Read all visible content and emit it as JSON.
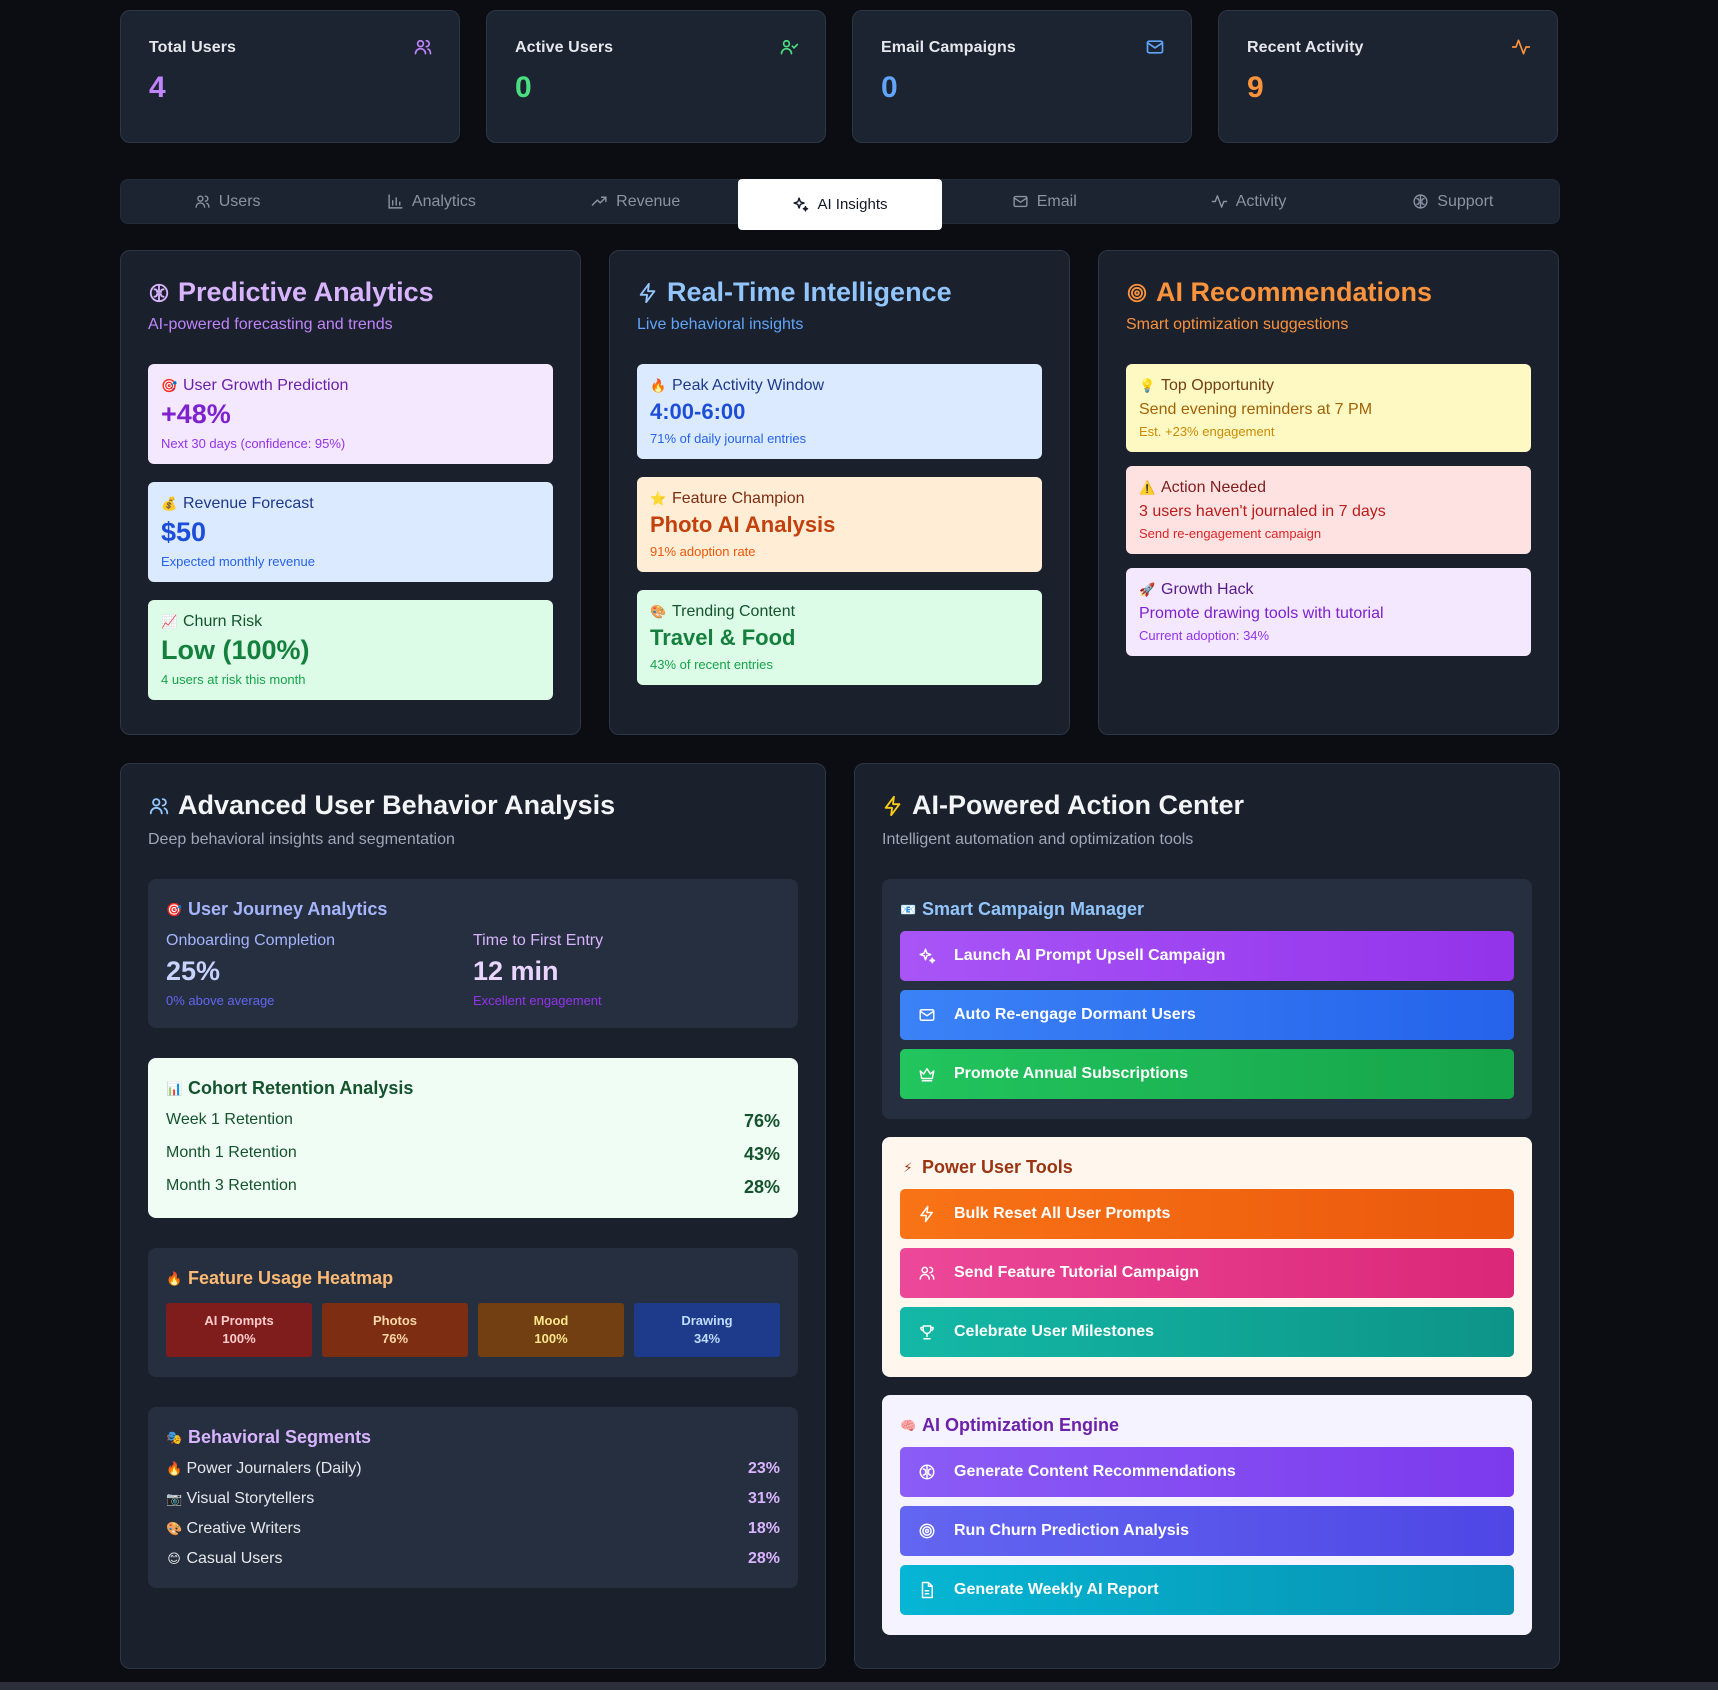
{
  "stats": [
    {
      "label": "Total Users",
      "value": "4",
      "color": "#c084fc",
      "icon": "users-icon"
    },
    {
      "label": "Active Users",
      "value": "0",
      "color": "#4ade80",
      "icon": "user-check-icon"
    },
    {
      "label": "Email Campaigns",
      "value": "0",
      "color": "#60a5fa",
      "icon": "mail-icon"
    },
    {
      "label": "Recent Activity",
      "value": "9",
      "color": "#fb923c",
      "icon": "activity-icon"
    }
  ],
  "tabs": [
    {
      "label": "Users",
      "icon": "users-icon"
    },
    {
      "label": "Analytics",
      "icon": "bar-chart-icon"
    },
    {
      "label": "Revenue",
      "icon": "trending-up-icon"
    },
    {
      "label": "AI Insights",
      "icon": "sparkles-icon",
      "active": true
    },
    {
      "label": "Email",
      "icon": "mail-icon"
    },
    {
      "label": "Activity",
      "icon": "activity-icon"
    },
    {
      "label": "Support",
      "icon": "brain-icon"
    }
  ],
  "predictive": {
    "title": "Predictive Analytics",
    "subtitle": "AI-powered forecasting and trends",
    "cards": [
      {
        "emoji": "🎯",
        "label": "User Growth Prediction",
        "value": "+48%",
        "note": "Next 30 days (confidence: 95%)"
      },
      {
        "emoji": "💰",
        "label": "Revenue Forecast",
        "value": "$50",
        "note": "Expected monthly revenue"
      },
      {
        "emoji": "📈",
        "label": "Churn Risk",
        "value": "Low (100%)",
        "note": "4 users at risk this month"
      }
    ]
  },
  "realtime": {
    "title": "Real-Time Intelligence",
    "subtitle": "Live behavioral insights",
    "cards": [
      {
        "emoji": "🔥",
        "label": "Peak Activity Window",
        "value": "4:00-6:00",
        "note": "71% of daily journal entries"
      },
      {
        "emoji": "⭐",
        "label": "Feature Champion",
        "value": "Photo AI Analysis",
        "note": "91% adoption rate"
      },
      {
        "emoji": "🎨",
        "label": "Trending Content",
        "value": "Travel & Food",
        "note": "43% of recent entries"
      }
    ]
  },
  "recommendations": {
    "title": "AI Recommendations",
    "subtitle": "Smart optimization suggestions",
    "cards": [
      {
        "emoji": "💡",
        "label": "Top Opportunity",
        "body": "Send evening reminders at 7 PM",
        "note": "Est. +23% engagement"
      },
      {
        "emoji": "⚠️",
        "label": "Action Needed",
        "body": "3 users haven't journaled in 7 days",
        "note": "Send re-engagement campaign"
      },
      {
        "emoji": "🚀",
        "label": "Growth Hack",
        "body": "Promote drawing tools with tutorial",
        "note": "Current adoption: 34%"
      }
    ]
  },
  "behavior": {
    "title": "Advanced User Behavior Analysis",
    "subtitle": "Deep behavioral insights and segmentation",
    "journey": {
      "emoji": "🎯",
      "title": "User Journey Analytics",
      "items": [
        {
          "label": "Onboarding Completion",
          "value": "25%",
          "note": "0% above average"
        },
        {
          "label": "Time to First Entry",
          "value": "12 min",
          "note": "Excellent engagement"
        }
      ]
    },
    "cohort": {
      "emoji": "📊",
      "title": "Cohort Retention Analysis",
      "rows": [
        {
          "label": "Week 1 Retention",
          "value": "76%"
        },
        {
          "label": "Month 1 Retention",
          "value": "43%"
        },
        {
          "label": "Month 3 Retention",
          "value": "28%"
        }
      ]
    },
    "heatmap": {
      "emoji": "🔥",
      "title": "Feature Usage Heatmap",
      "cells": [
        {
          "label": "AI Prompts",
          "value": "100%",
          "bg": "#7f1d1d",
          "fg": "#fecaca"
        },
        {
          "label": "Photos",
          "value": "76%",
          "bg": "#7c2d12",
          "fg": "#fed7aa"
        },
        {
          "label": "Mood",
          "value": "100%",
          "bg": "#713f12",
          "fg": "#fde68a"
        },
        {
          "label": "Drawing",
          "value": "34%",
          "bg": "#1e3a8a",
          "fg": "#bfdbfe"
        }
      ]
    },
    "segments": {
      "emoji": "🎭",
      "title": "Behavioral Segments",
      "rows": [
        {
          "emoji": "🔥",
          "label": "Power Journalers (Daily)",
          "value": "23%"
        },
        {
          "emoji": "📷",
          "label": "Visual Storytellers",
          "value": "31%"
        },
        {
          "emoji": "🎨",
          "label": "Creative Writers",
          "value": "18%"
        },
        {
          "emoji": "😊",
          "label": "Casual Users",
          "value": "28%"
        }
      ]
    }
  },
  "actions": {
    "title": "AI-Powered Action Center",
    "subtitle": "Intelligent automation and optimization tools",
    "groups": [
      {
        "emoji": "📧",
        "title": "Smart Campaign Manager",
        "buttons": [
          {
            "label": "Launch AI Prompt Upsell Campaign",
            "icon": "sparkles-icon",
            "color": "#9333ea"
          },
          {
            "label": "Auto Re-engage Dormant Users",
            "icon": "mail-icon",
            "color": "#2563eb"
          },
          {
            "label": "Promote Annual Subscriptions",
            "icon": "crown-icon",
            "color": "#16a34a"
          }
        ]
      },
      {
        "emoji": "⚡",
        "title": "Power User Tools",
        "buttons": [
          {
            "label": "Bulk Reset All User Prompts",
            "icon": "zap-icon",
            "color": "#ea580c"
          },
          {
            "label": "Send Feature Tutorial Campaign",
            "icon": "users-icon",
            "color": "#db2777"
          },
          {
            "label": "Celebrate User Milestones",
            "icon": "trophy-icon",
            "color": "#0d9488"
          }
        ]
      },
      {
        "emoji": "🧠",
        "title": "AI Optimization Engine",
        "buttons": [
          {
            "label": "Generate Content Recommendations",
            "icon": "brain-icon",
            "color": "#7c3aed"
          },
          {
            "label": "Run Churn Prediction Analysis",
            "icon": "target-icon",
            "color": "#4f46e5"
          },
          {
            "label": "Generate Weekly AI Report",
            "icon": "file-icon",
            "color": "#0891b2"
          }
        ]
      }
    ]
  }
}
